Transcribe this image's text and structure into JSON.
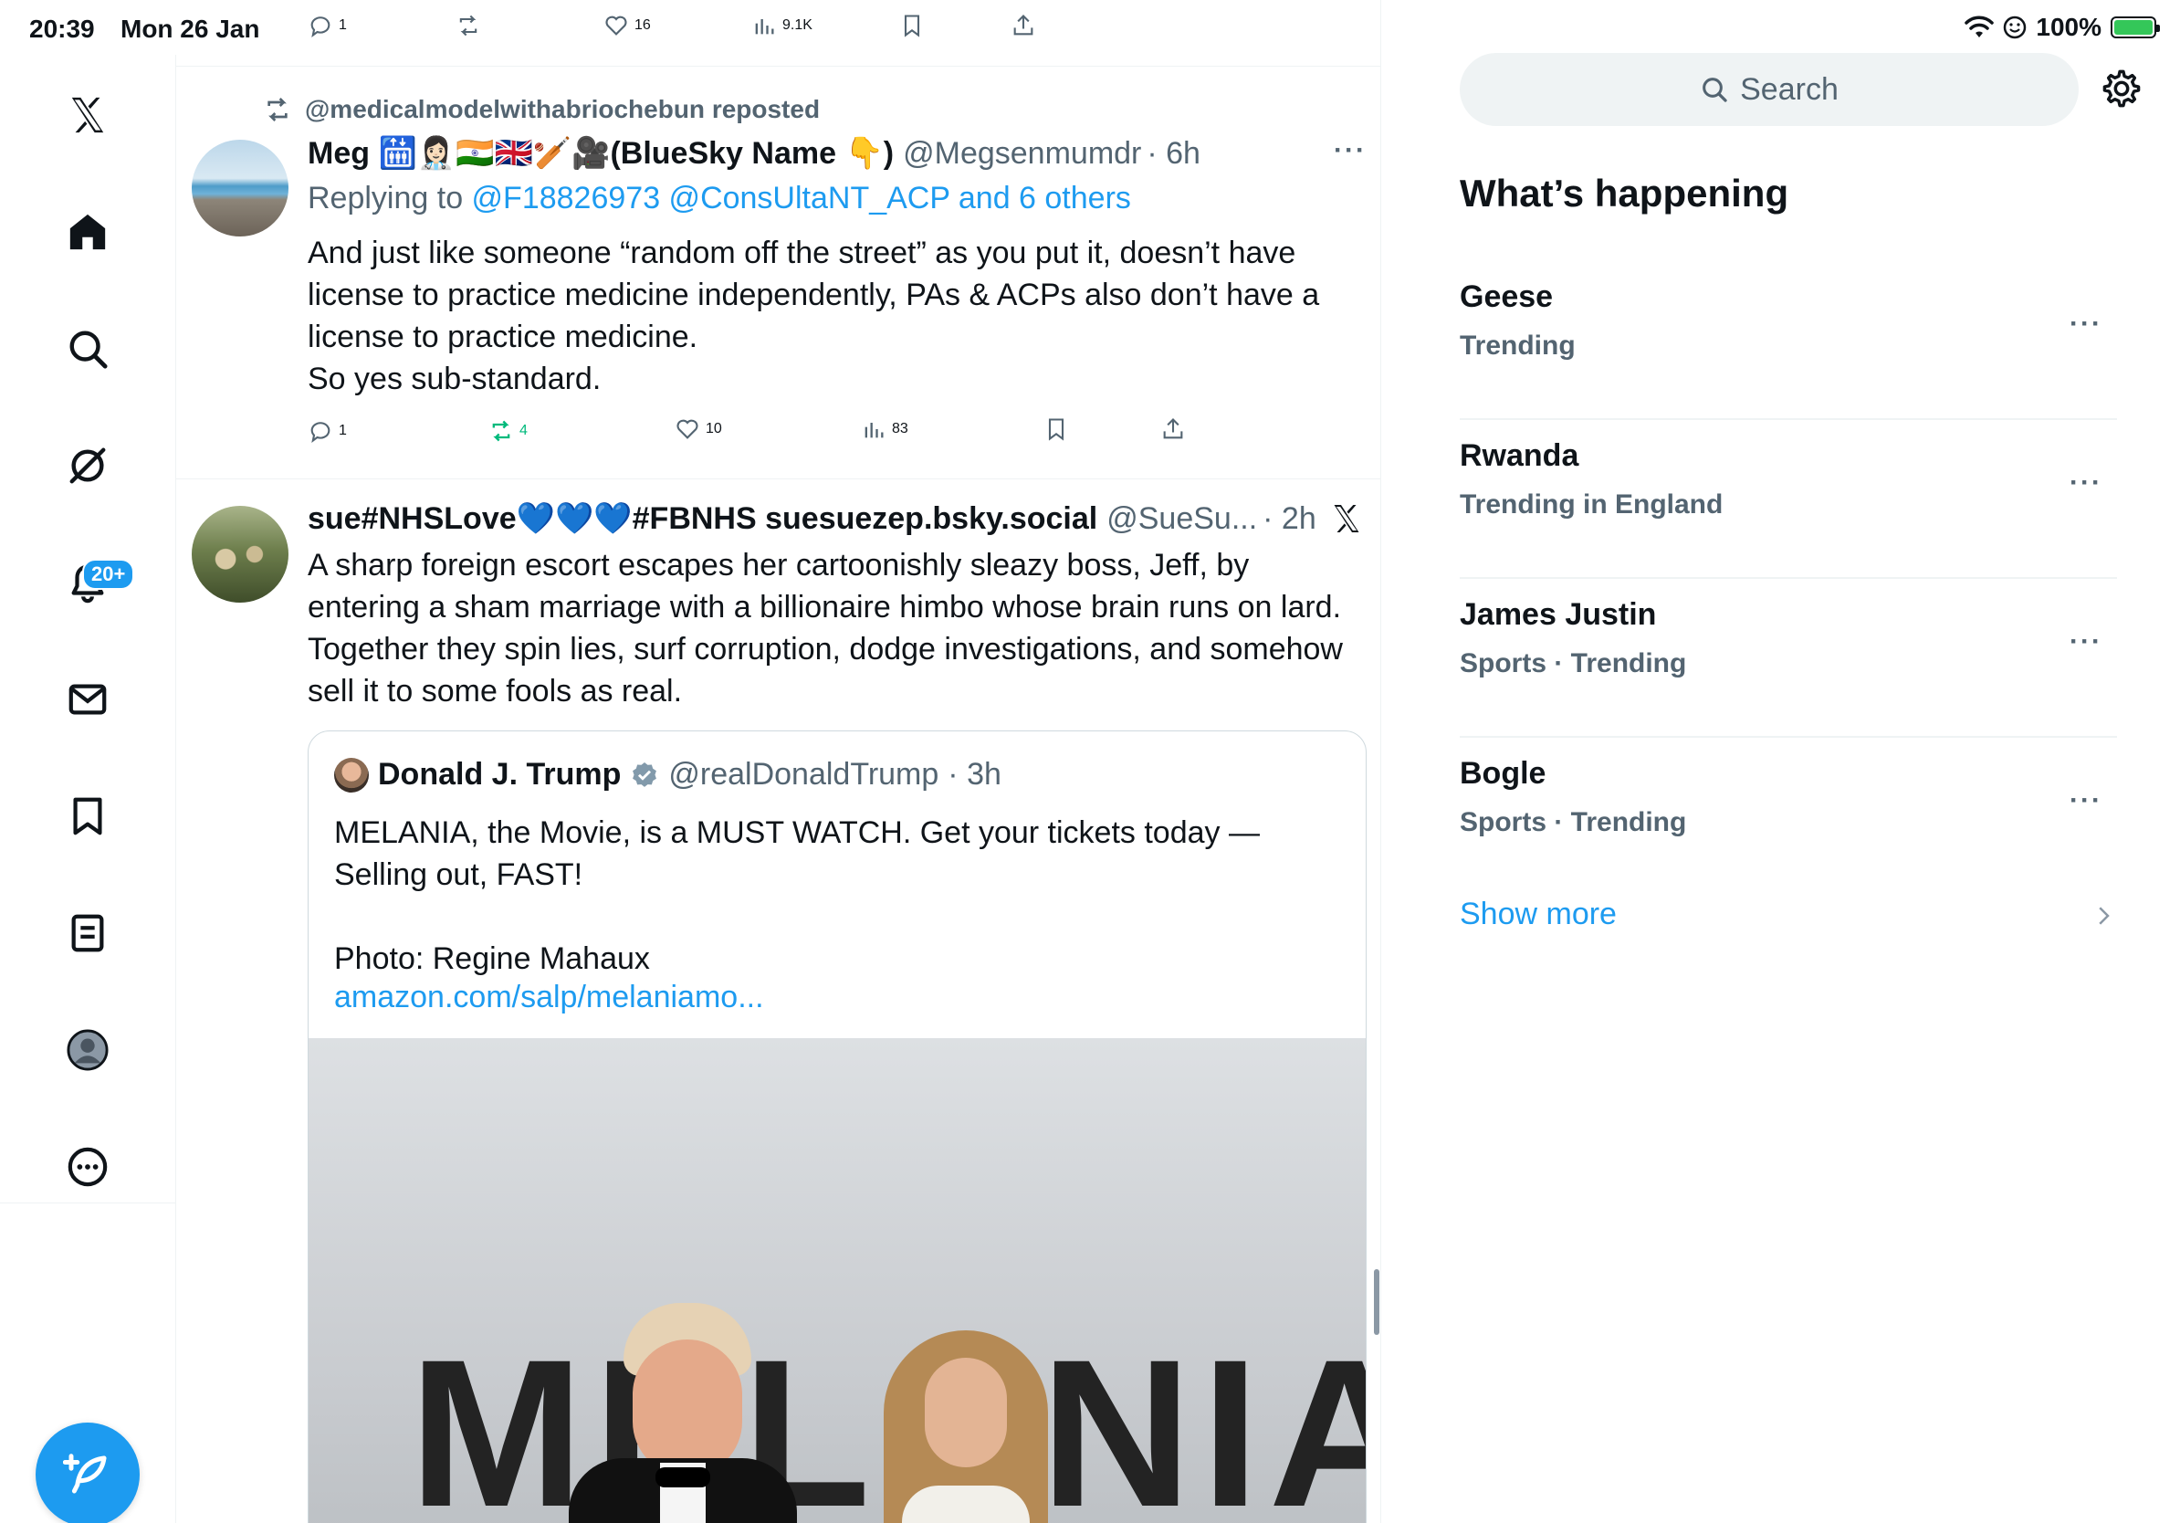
{
  "status": {
    "time": "20:39",
    "date": "Mon 26 Jan",
    "battery": "100%"
  },
  "nav": {
    "notifications_badge": "20+"
  },
  "top_actions": {
    "replies": "1",
    "reposts": "",
    "likes": "16",
    "views": "9.1K"
  },
  "tweet1": {
    "reposted_by": "@medicalmodelwithabriochebun reposted",
    "name": "Meg 🛗👩🏻‍⚕️🇮🇳🇬🇧🏏🎥(BlueSky Name 👇)",
    "handle": "@Megsenmumdr",
    "time": "· 6h",
    "replying_prefix": "Replying to ",
    "replying_to": "@F18826973 @ConsUltaNT_ACP and 6 others",
    "text": "And just like someone “random off the street” as you put it, doesn’t have\nlicense to practice medicine independently, PAs & ACPs also don’t have a\nlicense to practice medicine.\nSo yes sub-standard.",
    "replies": "1",
    "reposts": "4",
    "likes": "10",
    "views": "83"
  },
  "tweet2": {
    "name": "sue#NHSLove💙💙💙#FBNHS suesuezep.bsky.social",
    "handle": "@SueSu...",
    "time": "· 2h",
    "text": "A sharp foreign escort escapes her cartoonishly sleazy boss, Jeff, by\nentering a sham marriage with a billionaire himbo whose brain runs on lard.\nTogether they spin lies, surf corruption, dodge investigations, and somehow\nsell it to some fools as real.",
    "quote": {
      "name": "Donald J. Trump",
      "handle": "@realDonaldTrump",
      "time": "· 3h",
      "text": "MELANIA, the Movie, is a MUST WATCH. Get your tickets today —\nSelling out, FAST!\n\nPhoto: Regine Mahaux",
      "link": "amazon.com/salp/melaniamo...",
      "image_text": "MELANIA"
    }
  },
  "sidebar": {
    "search_placeholder": "Search",
    "title": "What’s happening",
    "trends": [
      {
        "name": "Geese",
        "meta": "Trending"
      },
      {
        "name": "Rwanda",
        "meta": "Trending in England"
      },
      {
        "name": "James Justin",
        "meta": "Sports · Trending"
      },
      {
        "name": "Bogle",
        "meta": "Sports · Trending"
      }
    ],
    "show_more": "Show more"
  },
  "colors": {
    "accent": "#1d9bf0",
    "repost_active": "#00ba7c",
    "text_secondary": "#536471"
  }
}
